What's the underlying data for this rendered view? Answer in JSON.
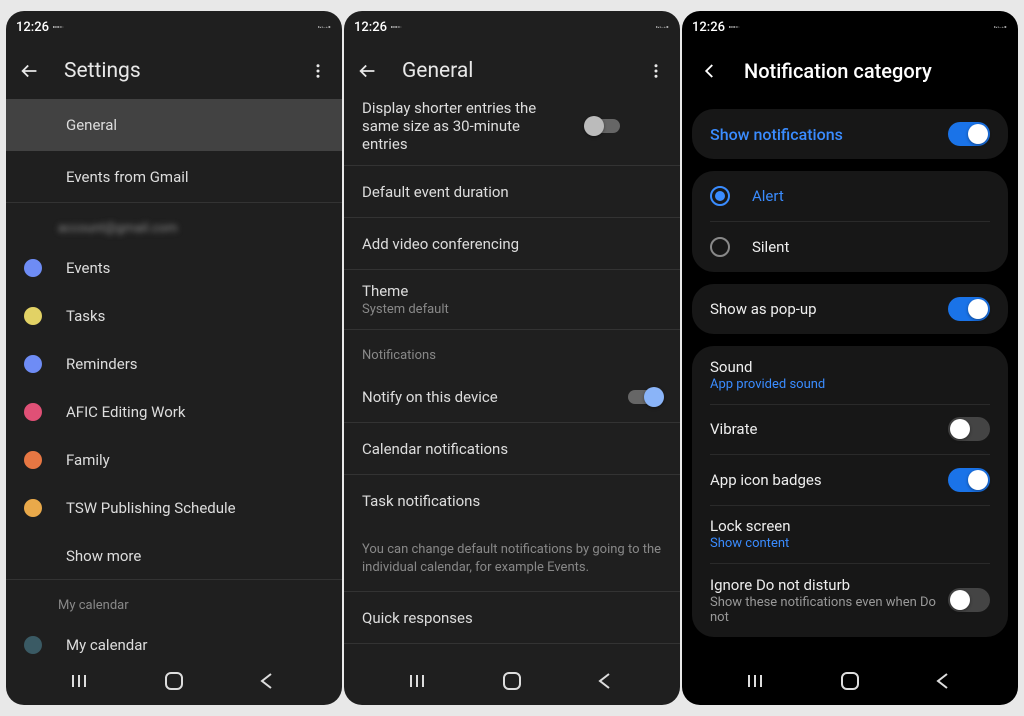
{
  "status": {
    "time": "12:26"
  },
  "screen1": {
    "title": "Settings",
    "items": [
      {
        "label": "General",
        "highlighted": true
      },
      {
        "label": "Events from Gmail"
      }
    ],
    "account_header": "account@gmail.com",
    "calendars": [
      {
        "label": "Events",
        "color": "#6e8cf5"
      },
      {
        "label": "Tasks",
        "color": "#e2d265"
      },
      {
        "label": "Reminders",
        "color": "#6e8cf5"
      },
      {
        "label": "AFIC Editing Work",
        "color": "#e05076"
      },
      {
        "label": "Family",
        "color": "#e77743"
      },
      {
        "label": "TSW Publishing Schedule",
        "color": "#e9a94a"
      }
    ],
    "show_more": "Show more",
    "my_calendar_header": "My calendar",
    "my_calendar_item": {
      "label": "My calendar",
      "color": "#3a5a64"
    }
  },
  "screen2": {
    "title": "General",
    "display_shorter": "Display shorter entries the same size as 30-minute entries",
    "items": [
      {
        "label": "Default event duration"
      },
      {
        "label": "Add video conferencing"
      }
    ],
    "theme": {
      "label": "Theme",
      "sub": "System default"
    },
    "notifications_header": "Notifications",
    "notify_device": "Notify on this device",
    "calendar_notifications": "Calendar notifications",
    "task_notifications": "Task notifications",
    "help_text": "You can change default notifications by going to the individual calendar, for example Events.",
    "quick_responses": "Quick responses"
  },
  "screen3": {
    "title": "Notification category",
    "show_notifications": "Show notifications",
    "alert": "Alert",
    "silent": "Silent",
    "show_popup": "Show as pop-up",
    "sound": {
      "label": "Sound",
      "sub": "App provided sound"
    },
    "vibrate": "Vibrate",
    "badges": "App icon badges",
    "lock_screen": {
      "label": "Lock screen",
      "sub": "Show content"
    },
    "ignore_dnd": {
      "label": "Ignore Do not disturb",
      "sub": "Show these notifications even when Do not"
    }
  }
}
